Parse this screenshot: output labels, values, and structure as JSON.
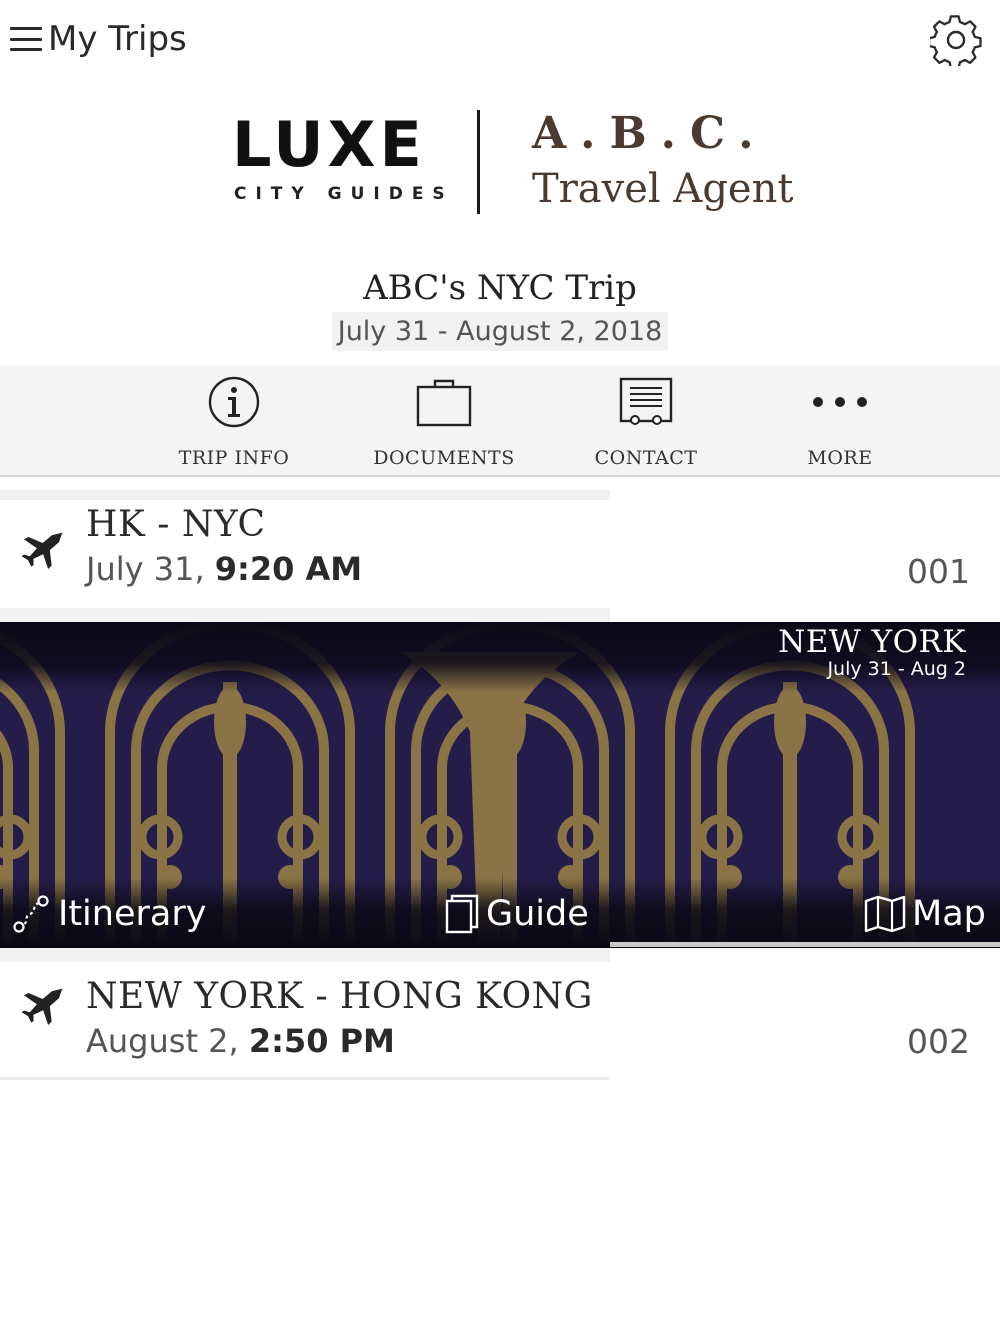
{
  "header": {
    "title": "My Trips",
    "menu_icon": "hamburger-menu-icon",
    "settings_icon": "gear-icon"
  },
  "logos": {
    "luxe_word": "LUXE",
    "luxe_sub": "CITY GUIDES",
    "agent_word": "A.B.C.",
    "agent_sub": "Travel Agent"
  },
  "trip": {
    "title": "ABC's NYC Trip",
    "dates": "July 31 - August 2, 2018"
  },
  "actions": [
    {
      "label": "TRIP INFO",
      "icon": "info-icon"
    },
    {
      "label": "DOCUMENTS",
      "icon": "briefcase-icon"
    },
    {
      "label": "CONTACT",
      "icon": "contact-card-icon"
    },
    {
      "label": "MORE",
      "icon": "more-dots-icon"
    }
  ],
  "flights": [
    {
      "route": "HK - NYC",
      "date": "July 31, ",
      "time": "9:20 AM",
      "code": "001",
      "icon": "plane-icon"
    },
    {
      "route": "NEW YORK - HONG KONG",
      "date": "August 2, ",
      "time": "2:50 PM",
      "code": "002",
      "icon": "plane-icon"
    }
  ],
  "city_banner": {
    "city": "NEW YORK",
    "dates": "July 31 - Aug 2",
    "buttons": [
      {
        "label": "Itinerary",
        "icon": "route-icon"
      },
      {
        "label": "Guide",
        "icon": "book-icon"
      },
      {
        "label": "Map",
        "icon": "map-icon"
      }
    ],
    "colors": {
      "background": "#241d4a",
      "ornament": "#8a7445"
    }
  }
}
